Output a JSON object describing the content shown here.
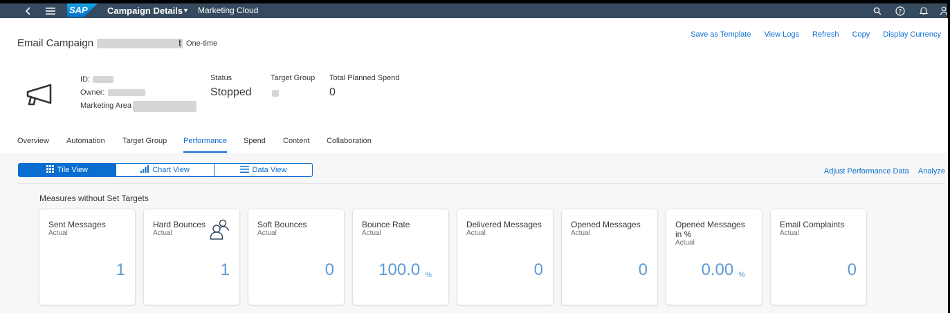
{
  "shell": {
    "title": "Campaign Details",
    "subtitle": "Marketing Cloud",
    "logo": "SAP"
  },
  "header": {
    "title_prefix": "Email Campaign",
    "title_suffix": "t",
    "type": "One-time",
    "actions": [
      "Save as Template",
      "View Logs",
      "Refresh",
      "Copy",
      "Display Currency"
    ],
    "attributes": {
      "id_label": "ID:",
      "owner_label": "Owner:",
      "area_label": "Marketing Area"
    },
    "status_label": "Status",
    "status_value": "Stopped",
    "target_group_label": "Target Group",
    "total_spend_label": "Total Planned Spend",
    "total_spend_value": "0"
  },
  "tabs": [
    "Overview",
    "Automation",
    "Target Group",
    "Performance",
    "Spend",
    "Content",
    "Collaboration"
  ],
  "active_tab": "Performance",
  "views": [
    "Tile View",
    "Chart View",
    "Data View"
  ],
  "active_view": "Tile View",
  "perf_links": [
    "Adjust Performance Data",
    "Analyze"
  ],
  "section_title": "Measures without Set Targets",
  "tiles": [
    {
      "name": "Sent Messages",
      "sub": "Actual",
      "value": "1",
      "unit": ""
    },
    {
      "name": "Hard Bounces",
      "sub": "Actual",
      "value": "1",
      "unit": ""
    },
    {
      "name": "Soft Bounces",
      "sub": "Actual",
      "value": "0",
      "unit": ""
    },
    {
      "name": "Bounce Rate",
      "sub": "Actual",
      "value": "100.0",
      "unit": "%"
    },
    {
      "name": "Delivered Messages",
      "sub": "Actual",
      "value": "0",
      "unit": ""
    },
    {
      "name": "Opened Messages",
      "sub": "Actual",
      "value": "0",
      "unit": ""
    },
    {
      "name": "Opened Messages in %",
      "sub": "Actual",
      "value": "0.00",
      "unit": "%"
    },
    {
      "name": "Email Complaints",
      "sub": "Actual",
      "value": "0",
      "unit": ""
    }
  ],
  "colors": {
    "shell": "#354a5f",
    "accent": "#0a6ed1",
    "kpi": "#5b9bd5"
  },
  "icons": [
    "back-icon",
    "menu-icon",
    "search-icon",
    "help-icon",
    "bell-icon",
    "user-icon",
    "megaphone-icon",
    "grid-icon",
    "bar-chart-icon",
    "list-icon",
    "people-icon"
  ]
}
